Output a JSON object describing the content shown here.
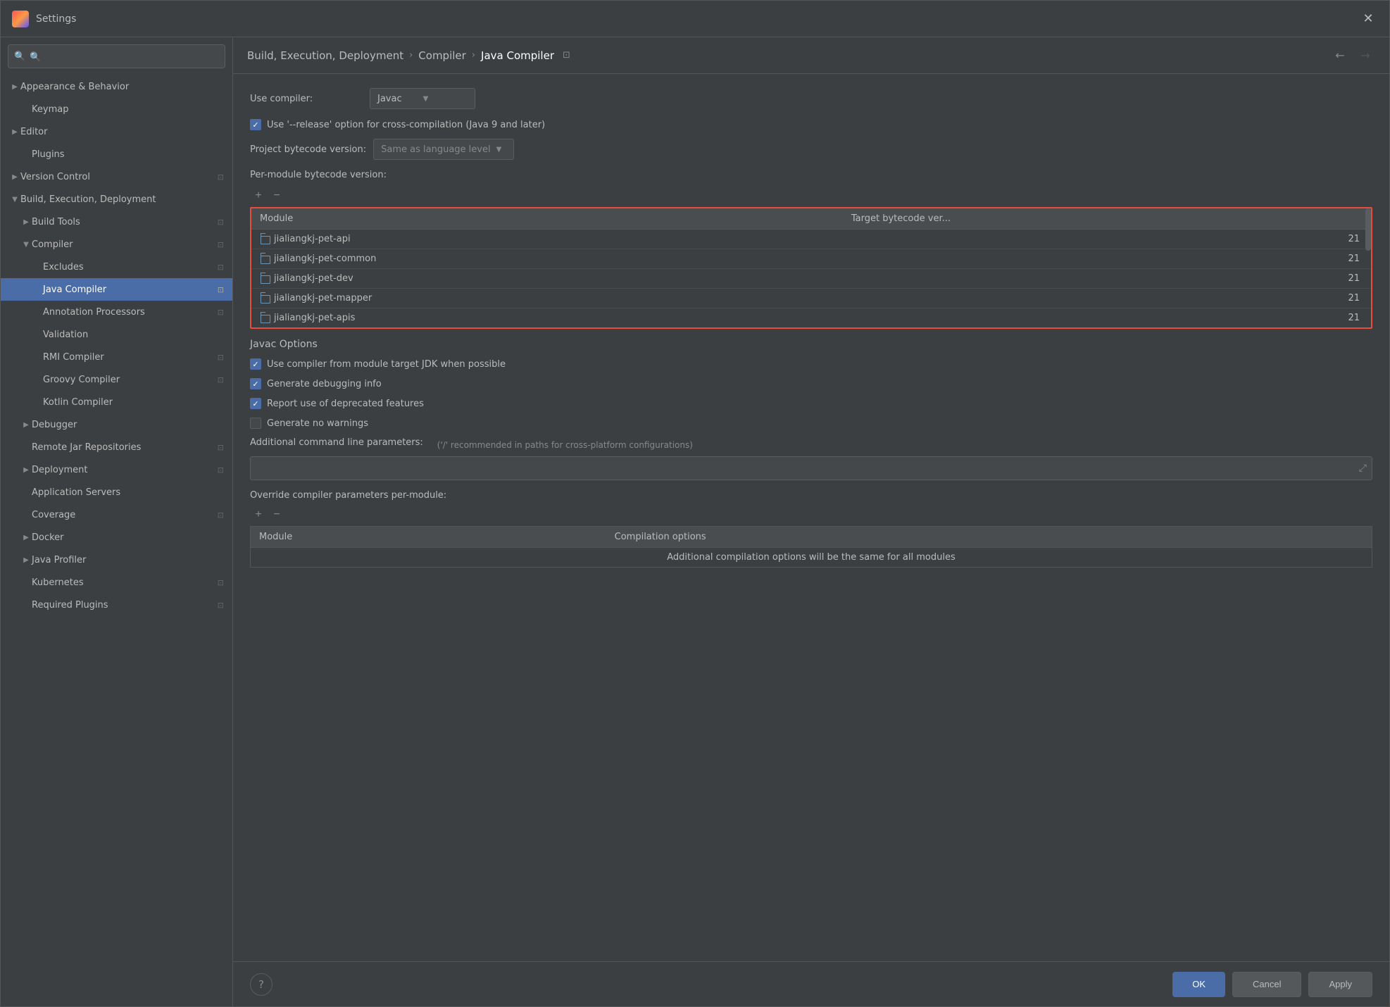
{
  "window": {
    "title": "Settings",
    "icon": "app-icon"
  },
  "breadcrumb": {
    "items": [
      "Build, Execution, Deployment",
      "Compiler",
      "Java Compiler"
    ],
    "pin_label": "⊡"
  },
  "sidebar": {
    "search_placeholder": "🔍",
    "items": [
      {
        "id": "appearance",
        "label": "Appearance & Behavior",
        "indent": 0,
        "expandable": true,
        "expanded": false,
        "pin": false
      },
      {
        "id": "keymap",
        "label": "Keymap",
        "indent": 1,
        "expandable": false,
        "pin": false
      },
      {
        "id": "editor",
        "label": "Editor",
        "indent": 0,
        "expandable": true,
        "expanded": false,
        "pin": false
      },
      {
        "id": "plugins",
        "label": "Plugins",
        "indent": 1,
        "expandable": false,
        "pin": false
      },
      {
        "id": "version-control",
        "label": "Version Control",
        "indent": 0,
        "expandable": true,
        "expanded": false,
        "pin": true
      },
      {
        "id": "build-execution",
        "label": "Build, Execution, Deployment",
        "indent": 0,
        "expandable": true,
        "expanded": true,
        "pin": false
      },
      {
        "id": "build-tools",
        "label": "Build Tools",
        "indent": 1,
        "expandable": true,
        "expanded": false,
        "pin": true
      },
      {
        "id": "compiler",
        "label": "Compiler",
        "indent": 1,
        "expandable": true,
        "expanded": true,
        "pin": true
      },
      {
        "id": "excludes",
        "label": "Excludes",
        "indent": 2,
        "expandable": false,
        "pin": true
      },
      {
        "id": "java-compiler",
        "label": "Java Compiler",
        "indent": 2,
        "expandable": false,
        "selected": true,
        "pin": true
      },
      {
        "id": "annotation-processors",
        "label": "Annotation Processors",
        "indent": 2,
        "expandable": false,
        "pin": true
      },
      {
        "id": "validation",
        "label": "Validation",
        "indent": 2,
        "expandable": false,
        "pin": false
      },
      {
        "id": "rmi-compiler",
        "label": "RMI Compiler",
        "indent": 2,
        "expandable": false,
        "pin": true
      },
      {
        "id": "groovy-compiler",
        "label": "Groovy Compiler",
        "indent": 2,
        "expandable": false,
        "pin": true
      },
      {
        "id": "kotlin-compiler",
        "label": "Kotlin Compiler",
        "indent": 2,
        "expandable": false,
        "pin": false
      },
      {
        "id": "debugger",
        "label": "Debugger",
        "indent": 1,
        "expandable": true,
        "expanded": false,
        "pin": false
      },
      {
        "id": "remote-jar",
        "label": "Remote Jar Repositories",
        "indent": 1,
        "expandable": false,
        "pin": true
      },
      {
        "id": "deployment",
        "label": "Deployment",
        "indent": 1,
        "expandable": true,
        "expanded": false,
        "pin": true
      },
      {
        "id": "application-servers",
        "label": "Application Servers",
        "indent": 1,
        "expandable": false,
        "pin": false
      },
      {
        "id": "coverage",
        "label": "Coverage",
        "indent": 1,
        "expandable": false,
        "pin": true
      },
      {
        "id": "docker",
        "label": "Docker",
        "indent": 1,
        "expandable": true,
        "expanded": false,
        "pin": false
      },
      {
        "id": "java-profiler",
        "label": "Java Profiler",
        "indent": 1,
        "expandable": true,
        "expanded": false,
        "pin": false
      },
      {
        "id": "kubernetes",
        "label": "Kubernetes",
        "indent": 1,
        "expandable": false,
        "pin": true
      },
      {
        "id": "required-plugins",
        "label": "Required Plugins",
        "indent": 1,
        "expandable": false,
        "pin": true
      }
    ]
  },
  "main": {
    "use_compiler_label": "Use compiler:",
    "use_compiler_value": "Javac",
    "use_release_option_label": "Use '--release' option for cross-compilation (Java 9 and later)",
    "use_release_checked": true,
    "project_bytecode_label": "Project bytecode version:",
    "project_bytecode_value": "Same as language level",
    "per_module_label": "Per-module bytecode version:",
    "table_add": "+",
    "table_remove": "−",
    "module_col_header": "Module",
    "target_col_header": "Target bytecode ver...",
    "modules": [
      {
        "name": "jialiangkj-pet-api",
        "target": "21"
      },
      {
        "name": "jialiangkj-pet-common",
        "target": "21"
      },
      {
        "name": "jialiangkj-pet-dev",
        "target": "21"
      },
      {
        "name": "jialiangkj-pet-mapper",
        "target": "21"
      },
      {
        "name": "jialiangkj-pet-apis",
        "target": "21"
      }
    ],
    "javac_options_title": "Javac Options",
    "option_use_module_jdk": "Use compiler from module target JDK when possible",
    "option_use_module_jdk_checked": true,
    "option_debug_info": "Generate debugging info",
    "option_debug_info_checked": true,
    "option_deprecated": "Report use of deprecated features",
    "option_deprecated_checked": true,
    "option_no_warnings": "Generate no warnings",
    "option_no_warnings_checked": false,
    "additional_params_label": "Additional command line parameters:",
    "additional_params_note": "('/' recommended in paths for cross-platform configurations)",
    "params_input_value": "",
    "params_input_placeholder": "",
    "expand_icon": "⤢",
    "override_label": "Override compiler parameters per-module:",
    "override_add": "+",
    "override_remove": "−",
    "override_module_col": "Module",
    "override_options_col": "Compilation options",
    "override_empty_msg": "Additional compilation options will be the same for all modules"
  },
  "bottom": {
    "help_label": "?",
    "ok_label": "OK",
    "cancel_label": "Cancel",
    "apply_label": "Apply"
  },
  "colors": {
    "selected_bg": "#4a6da7",
    "highlight_border": "#e74c3c",
    "ok_btn": "#4a6da7"
  }
}
